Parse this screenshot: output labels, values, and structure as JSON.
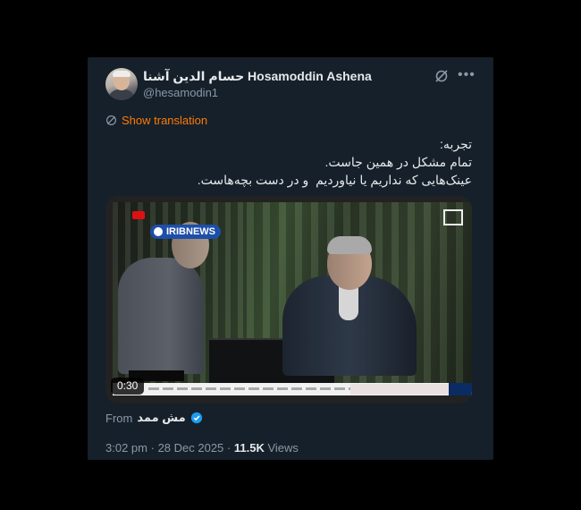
{
  "author": {
    "display_name": "حسام الدین آشنا Hosamoddin Ashena",
    "handle": "@hesamodin1"
  },
  "show_translation": "Show translation",
  "tweet_text": "تجربه:\nتمام مشکل در همین جاست.\nعینک‌هایی که نداریم یا نیاوردیم  و در دست بچه‌هاست.",
  "media": {
    "duration": "0:30",
    "overlay_brand": "IRIBNEWS"
  },
  "source": {
    "label": "From",
    "name": "مش ممد"
  },
  "meta": {
    "time": "3:02 pm",
    "date": "28 Dec 2025",
    "views_count": "11.5K",
    "views_label": "Views"
  },
  "icons": {
    "grok": "grok-icon",
    "more": "more-icon",
    "translate": "translate-icon",
    "verified": "verified-icon"
  },
  "colors": {
    "background": "#15202b",
    "accent_translate": "#ff7a00",
    "verified": "#1d9bf0"
  }
}
